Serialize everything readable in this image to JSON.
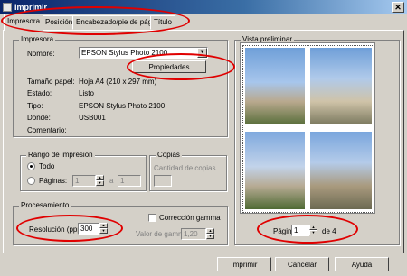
{
  "window": {
    "title": "Imprimir",
    "close_glyph": "✕"
  },
  "tabs": [
    {
      "label": "Impresora",
      "active": true
    },
    {
      "label": "Posición"
    },
    {
      "label": "Encabezado/pie de página"
    },
    {
      "label": "Título"
    }
  ],
  "printer_group": {
    "legend": "Impresora",
    "name_label": "Nombre:",
    "name_value": "EPSON Stylus Photo 2100",
    "properties_button": "Propiedades",
    "paper_label": "Tamaño papel:",
    "paper_value": "Hoja A4 (210 x 297 mm)",
    "status_label": "Estado:",
    "status_value": "Listo",
    "type_label": "Tipo:",
    "type_value": "EPSON Stylus Photo 2100",
    "where_label": "Donde:",
    "where_value": "USB001",
    "comment_label": "Comentario:"
  },
  "range_group": {
    "legend": "Rango de impresión",
    "all_label": "Todo",
    "pages_label": "Páginas:",
    "from_value": "1",
    "to_label": "a",
    "to_value": "1"
  },
  "copies_group": {
    "legend": "Copias",
    "count_label": "Cantidad de copias"
  },
  "processing_group": {
    "legend": "Procesamiento",
    "resolution_label": "Resolución (ppp)",
    "resolution_value": "300",
    "gamma_check_label": "Corrección gamma",
    "gamma_value_label": "Valor de gamma",
    "gamma_value": "1,20"
  },
  "preview": {
    "legend": "Vista preliminar",
    "page_label": "Página",
    "page_value": "1",
    "of_label": "de 4"
  },
  "buttons": {
    "print": "Imprimir",
    "cancel": "Cancelar",
    "help": "Ayuda"
  },
  "colors": {
    "highlight_oval": "#e00000",
    "titlebar": "#0a246a",
    "sky": "#6f9fd8"
  }
}
